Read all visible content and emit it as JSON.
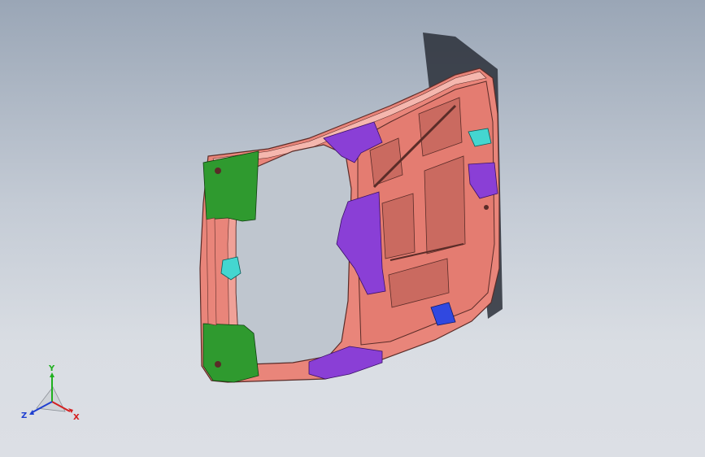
{
  "viewport": {
    "model": "door-inner-frame-assembly",
    "colors": {
      "background_top": "#9aa6b6",
      "background_bottom": "#dcdfe5",
      "panel_main": "#e9857a",
      "panel_highlight": "#f5b7ae",
      "edge_lines": "#5a2c28",
      "bracket_purple": "#8a3fd6",
      "reinforcement_green": "#2f9a2f",
      "clip_cyan": "#44d6d0",
      "clip_blue": "#3048e0",
      "shadow": "#2a2f38"
    }
  },
  "triad": {
    "icon": "axis-triad-icon",
    "x_label": "X",
    "y_label": "Y",
    "z_label": "Z",
    "x_color": "#d42020",
    "y_color": "#20b020",
    "z_color": "#2040d0"
  }
}
